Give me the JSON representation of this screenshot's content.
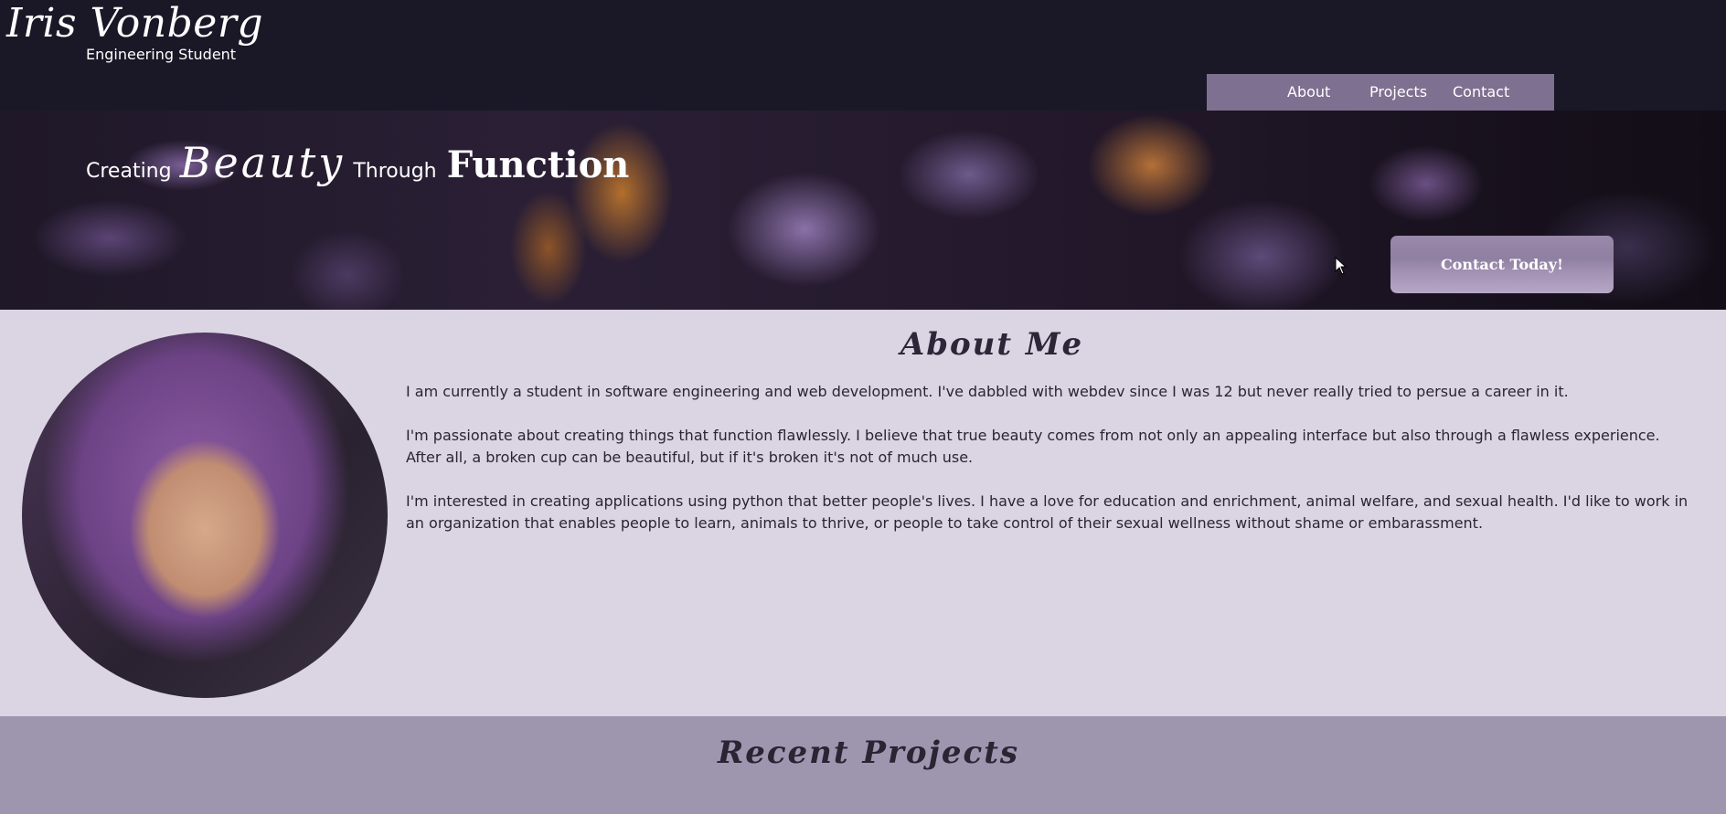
{
  "header": {
    "name": "Iris Vonberg",
    "subtitle": "Engineering Student"
  },
  "nav": {
    "items": [
      "About",
      "Projects",
      "Contact"
    ]
  },
  "hero": {
    "tagline": [
      "Creating",
      "Beauty",
      "Through",
      "Function"
    ],
    "cta_label": "Contact Today!"
  },
  "about": {
    "title": "About Me",
    "paragraphs": [
      "I am currently a student in software engineering and web development. I've dabbled with webdev since I was 12 but never really tried to persue a career in it.",
      "I'm passionate about creating things that function flawlessly. I believe that true beauty comes from not only an appealing interface but also through a flawless experience. After all, a broken cup can be beautiful, but if it's broken it's not of much use.",
      "I'm interested in creating applications using python that better people's lives. I have a love for education and enrichment, animal welfare, and sexual health. I'd like to work in an organization that enables people to learn, animals to thrive, or people to take control of their sexual wellness without shame or embarassment."
    ]
  },
  "projects": {
    "title": "Recent Projects"
  },
  "colors": {
    "header_bg": "#1a1826",
    "nav_bg": "#7e7090",
    "about_bg": "#dbd5e3",
    "projects_bg": "#9e95af",
    "cta_bg": "#9a89aa"
  },
  "icons": {
    "cursor": "mouse-pointer-icon"
  }
}
